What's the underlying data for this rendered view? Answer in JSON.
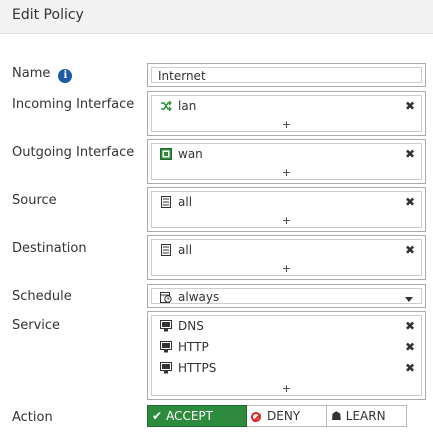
{
  "header": {
    "title": "Edit Policy"
  },
  "labels": {
    "name": "Name",
    "incoming": "Incoming Interface",
    "outgoing": "Outgoing Interface",
    "source": "Source",
    "destination": "Destination",
    "schedule": "Schedule",
    "service": "Service",
    "action": "Action"
  },
  "name_value": "Internet",
  "incoming": {
    "items": [
      "lan"
    ],
    "add": "+"
  },
  "outgoing": {
    "items": [
      "wan"
    ],
    "add": "+"
  },
  "source": {
    "items": [
      "all"
    ],
    "add": "+"
  },
  "destination": {
    "items": [
      "all"
    ],
    "add": "+"
  },
  "schedule": {
    "value": "always"
  },
  "service": {
    "items": [
      "DNS",
      "HTTP",
      "HTTPS"
    ],
    "add": "+"
  },
  "action": {
    "accept": "ACCEPT",
    "deny": "DENY",
    "learn": "LEARN",
    "selected": "accept"
  },
  "icons": {
    "remove": "✖",
    "accept_check": "✔",
    "learn_cap": "☗"
  },
  "colors": {
    "accept_bg": "#2e8b3d",
    "deny_red": "#dd2222",
    "info_blue": "#1e5aa8"
  }
}
